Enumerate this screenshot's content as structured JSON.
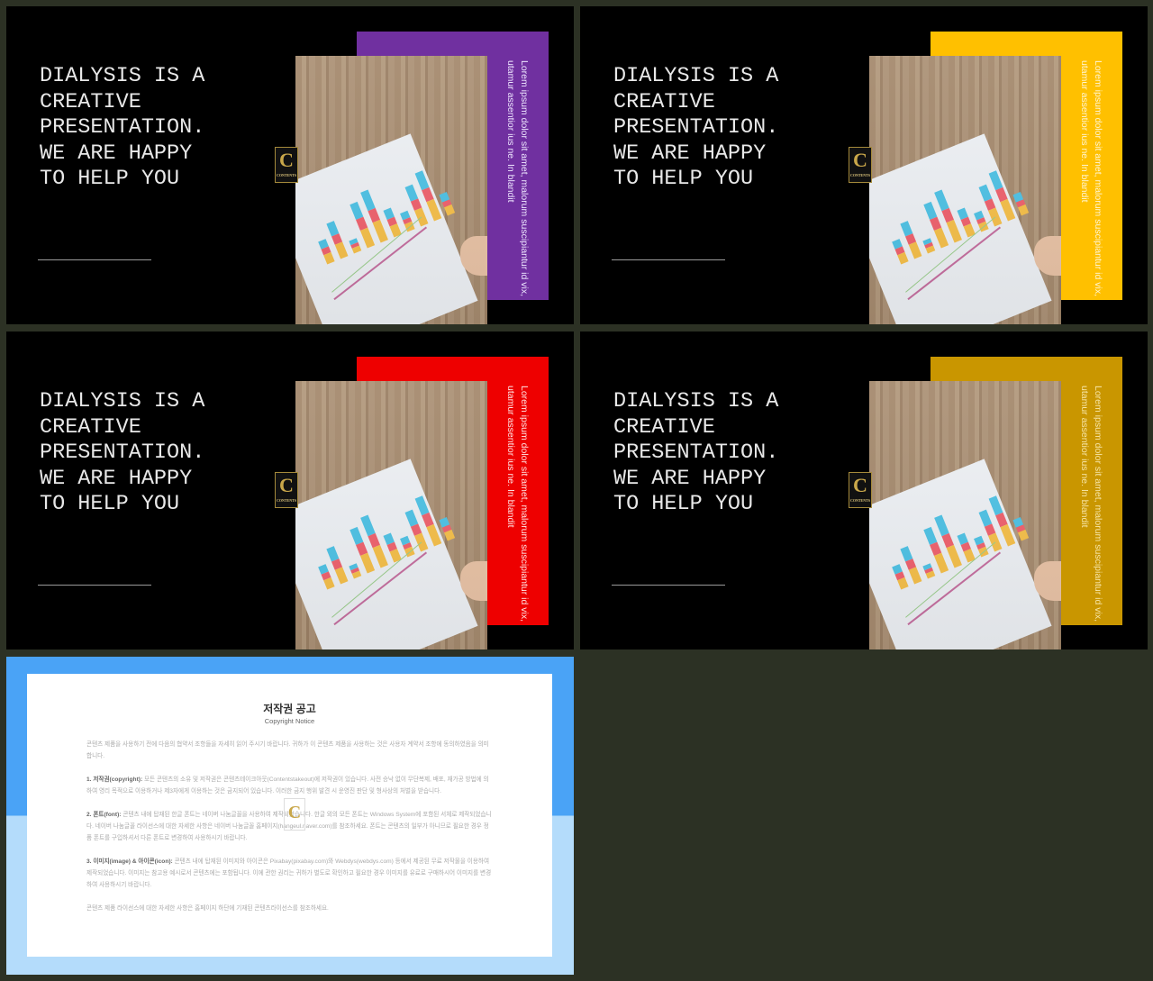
{
  "slides": [
    {
      "title": "DIALYSIS IS A\nCREATIVE\nPRESENTATION.\nWE ARE HAPPY\nTO HELP YOU",
      "side_text": "Lorem ipsum dolor sit amet, malorum suscipiantur id vix, utamur assentior ius ne. In blandit",
      "accent": "#7030a0",
      "side_text_color": "#eee6ff"
    },
    {
      "title": "DIALYSIS IS A\nCREATIVE\nPRESENTATION.\nWE ARE HAPPY\nTO HELP YOU",
      "side_text": "Lorem ipsum dolor sit amet, malorum suscipiantur id vix, utamur assentior ius ne. In blandit",
      "accent": "#ffc000",
      "side_text_color": "#fff6d5"
    },
    {
      "title": "DIALYSIS IS A\nCREATIVE\nPRESENTATION.\nWE ARE HAPPY\nTO HELP YOU",
      "side_text": "Lorem ipsum dolor sit amet, malorum suscipiantur id vix, utamur assentior ius ne. In blandit",
      "accent": "#ee0000",
      "side_text_color": "#ffe5e5"
    },
    {
      "title": "DIALYSIS IS A\nCREATIVE\nPRESENTATION.\nWE ARE HAPPY\nTO HELP YOU",
      "side_text": "Lorem ipsum dolor sit amet, malorum suscipiantur id vix, utamur assentior ius ne. In blandit",
      "accent": "#c99600",
      "side_text_color": "#f7e6a8"
    }
  ],
  "logo": {
    "letter": "C",
    "text": "CONTENTS"
  },
  "copyright": {
    "title": "저작권 공고",
    "subtitle": "Copyright Notice",
    "intro": "콘텐츠 제품을 사용하기 전에 다음의 협약서 조항들을 자세히 읽어 주시기 바랍니다. 귀하가 이 콘텐츠 제품을 사용하는 것은 사용자 계약서 조항에 동의하였음을 의미합니다.",
    "sections": [
      {
        "label": "1. 저작권(copyright):",
        "text": " 모든 콘텐츠의 소유 및 저작권은 콘텐츠테이크아웃(Contentstakeout)에 저작권이 있습니다. 사전 승낙 없이 무단복제, 배포, 재가공 방법에 의하여 영리 목적으로 이용하거나 제3자에게 이용하는 것은 금지되어 있습니다. 이러한 금지 행위 발견 시 운영진 판단 및 형사상의 처벌을 받습니다."
      },
      {
        "label": "2. 폰트(font):",
        "text": " 콘텐츠 내에 탑재된 한글 폰트는 네이버 나눔글꼴을 사용하여 제작되었습니다. 한글 외의 모든 폰트는 Windows System에 포함된 서체로 제작되었습니다. 네이버 나눔글꼴 라이선스에 대한 자세한 사항은 네이버 나눔글꼴 홈페이지(hangeul.naver.com)를 참조하세요. 폰트는 콘텐츠의 일부가 아니므로 필요한 경우 정품 폰트를 구입하셔서 다른 폰트로 변경하여 사용하시기 바랍니다."
      },
      {
        "label": "3. 이미지(image) & 아이콘(icon):",
        "text": " 콘텐츠 내에 탑재된 이미지와 아이콘은 Pixabay(pixabay.com)와 Webdys(webdys.com) 등에서 제공된 무료 저작물을 이용하여 제작되었습니다. 이미지는 참고용 예시로서 콘텐츠에는 포함됩니다. 이에 관한 권리는 귀하가 별도로 확인하고 필요한 경우 이미지를 유료로 구매하시어 이미지를 변경하여 사용하시기 바랍니다."
      }
    ],
    "footer": "콘텐츠 제품 라이선스에 대한 자세한 사항은 홈페이지 하단에 기재된 콘텐츠라이선스를 참조하세요."
  }
}
